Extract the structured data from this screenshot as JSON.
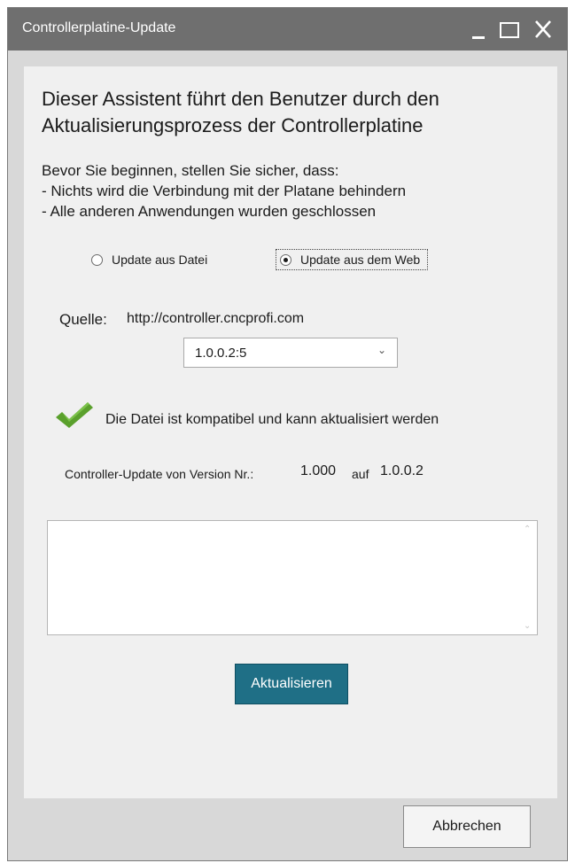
{
  "window": {
    "title": "Controllerplatine-Update"
  },
  "heading": {
    "line1": "Dieser Assistent führt den Benutzer durch den",
    "line2": "Aktualisierungsprozess der Controllerplatine"
  },
  "intro": {
    "line1": "Bevor Sie beginnen, stellen Sie sicher, dass:",
    "line2": "- Nichts wird die Verbindung mit der Platane behindern",
    "line3": "- Alle anderen Anwendungen wurden geschlossen"
  },
  "source_options": [
    {
      "label": "Update aus Datei",
      "selected": false
    },
    {
      "label": "Update aus dem Web",
      "selected": true
    }
  ],
  "source": {
    "label": "Quelle:",
    "url": "http://controller.cncprofi.com",
    "selected_version": "1.0.0.2:5"
  },
  "status": {
    "icon": "checkmark-icon",
    "color": "#5aa02c",
    "text": "Die Datei ist kompatibel und kann aktualisiert werden"
  },
  "version_info": {
    "prefix": "Controller-Update von Version Nr.:",
    "from_version": "1.000",
    "connector": "auf",
    "to_version": "1.0.0.2"
  },
  "buttons": {
    "update": "Aktualisieren",
    "cancel": "Abbrechen"
  },
  "colors": {
    "titlebar": "#6f6f6f",
    "accent_button": "#1f6f86",
    "content_bg": "#f0f0f0"
  }
}
